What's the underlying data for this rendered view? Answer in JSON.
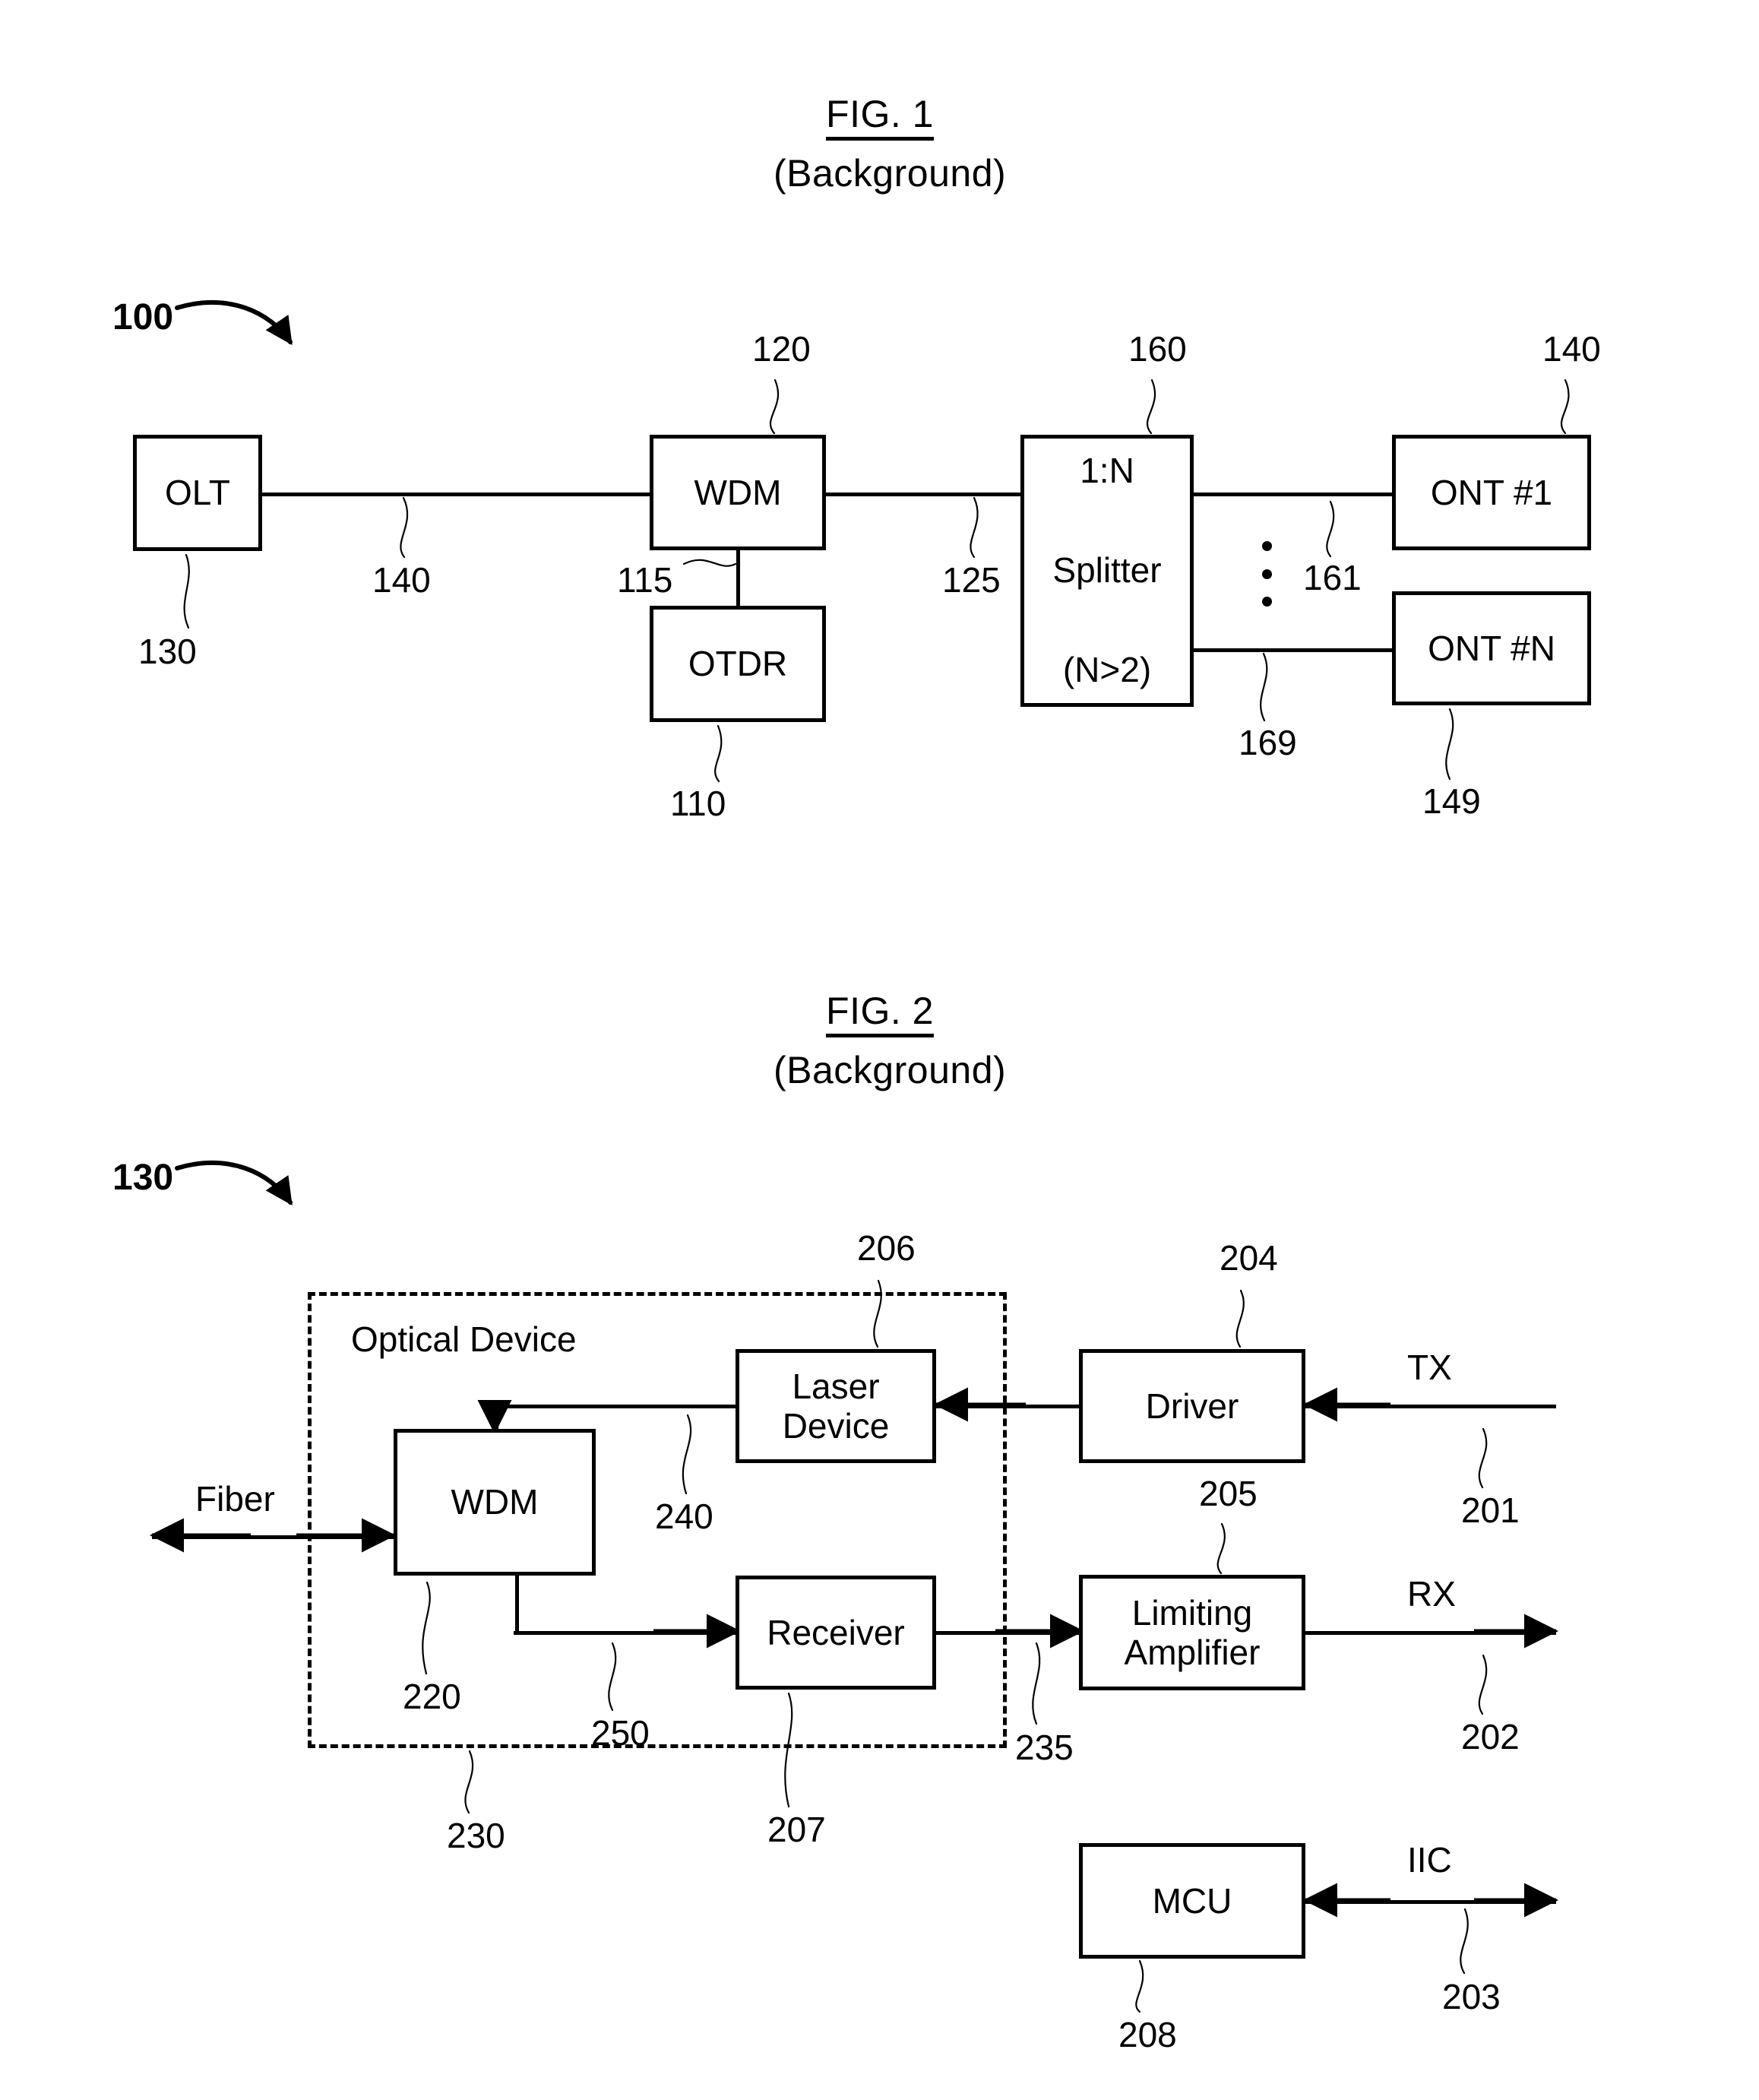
{
  "figures": [
    {
      "id": "fig1",
      "title": "FIG. 1",
      "subtitle": "(Background)",
      "system_ref": "100",
      "boxes": [
        {
          "key": "olt",
          "lines": [
            "OLT"
          ]
        },
        {
          "key": "wdm",
          "lines": [
            "WDM"
          ]
        },
        {
          "key": "otdr",
          "lines": [
            "OTDR"
          ]
        },
        {
          "key": "splitter",
          "lines": [
            "1:N",
            "Splitter",
            "(N>2)"
          ]
        },
        {
          "key": "ont1",
          "lines": [
            "ONT #1"
          ]
        },
        {
          "key": "ontn",
          "lines": [
            "ONT #N"
          ]
        }
      ],
      "refs": {
        "olt": "130",
        "olt_link": "140",
        "wdm": "120",
        "otdr": "110",
        "otdr_link": "115",
        "splitter_link": "125",
        "splitter": "160",
        "ont_link_top": "161",
        "ont_link_bottom": "169",
        "ont1": "140",
        "ontn": "149"
      }
    },
    {
      "id": "fig2",
      "title": "FIG. 2",
      "subtitle": "(Background)",
      "system_ref": "130",
      "enclosure_label": "Optical Device",
      "boxes": [
        {
          "key": "wdm",
          "lines": [
            "WDM"
          ]
        },
        {
          "key": "laser",
          "lines": [
            "Laser",
            "Device"
          ]
        },
        {
          "key": "receiver",
          "lines": [
            "Receiver"
          ]
        },
        {
          "key": "driver",
          "lines": [
            "Driver"
          ]
        },
        {
          "key": "limamp",
          "lines": [
            "Limiting",
            "Amplifier"
          ]
        },
        {
          "key": "mcu",
          "lines": [
            "MCU"
          ]
        }
      ],
      "signals": {
        "fiber": "Fiber",
        "tx": "TX",
        "rx": "RX",
        "iic": "IIC"
      },
      "refs": {
        "laser": "206",
        "driver": "204",
        "tx_line": "201",
        "laser_link": "240",
        "wdm": "220",
        "receiver_link": "250",
        "receiver": "207",
        "limamp": "205",
        "limamp_link": "235",
        "rx_line": "202",
        "enclosure": "230",
        "mcu": "208",
        "iic_line": "203"
      }
    }
  ]
}
